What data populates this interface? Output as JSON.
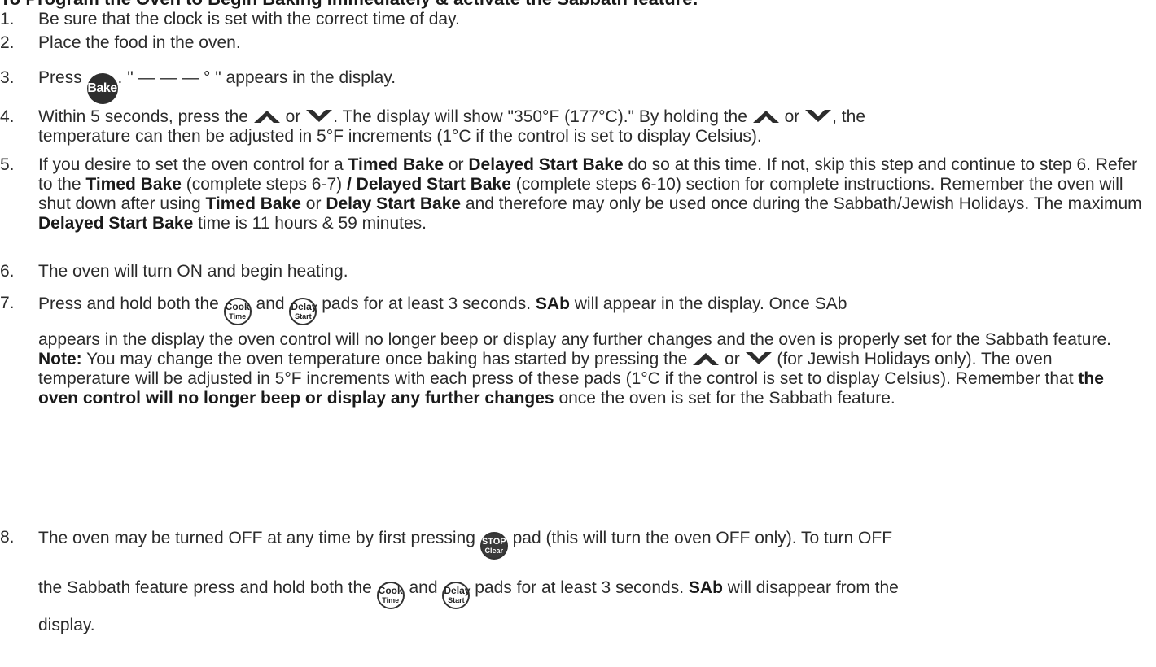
{
  "heading": "To Program the Oven to Begin Baking Immediately & activate the Sabbath feature:",
  "icons": {
    "bake": "Bake",
    "cook_time": [
      "Cook",
      "Time"
    ],
    "delay_start": [
      "Delay",
      "Start"
    ],
    "stop_clear": [
      "STOP",
      "Clear"
    ],
    "up": "up-arrow-pad",
    "down": "down-arrow-pad"
  },
  "steps": [
    {
      "num": "1.",
      "text": "Be sure that the clock is set with the correct time of day."
    },
    {
      "num": "2.",
      "text": "Place the food in the oven."
    },
    {
      "num": "3.",
      "a": "Press",
      "b": ". \" — — — ° \" appears in the display."
    },
    {
      "num": "4.",
      "a": "Within 5 seconds, press the",
      "or1": "or",
      "b": ". The display will show \"350°F (177°C).\" By holding the",
      "or2": "or",
      "c": ", the",
      "d": "temperature can then be adjusted in 5°F increments (1°C if the control is set to display Celsius)."
    },
    {
      "num": "5.",
      "t1": "If you desire to set the oven control for a ",
      "b1": "Timed Bake",
      "t2": " or ",
      "b2": "Delayed Start Bake",
      "t3": " do so at this time. If not, skip this step and continue to step 6. Refer to the ",
      "b3": "Timed Bake",
      "t4": " (complete steps 6-7) ",
      "b4": "/ Delayed Start Bake",
      "t5": " (complete steps 6-10) section for complete instructions. Remember the oven will shut down after using ",
      "b5": "Timed Bake",
      "t6": " or ",
      "b6": "Delay Start Bake",
      "t7": " and therefore may only be used once during the Sabbath/Jewish Holidays. The maximum ",
      "b7": "Delayed Start Bake",
      "t8": " time is 11 hours & 59 minutes."
    },
    {
      "num": "6.",
      "text": "The oven will turn ON and begin heating."
    },
    {
      "num": "7.",
      "a": "Press and hold both the",
      "and": "and",
      "b": "pads for at least 3 seconds.",
      "sab": "SAb",
      "c": "will appear in the display. Once SAb",
      "d": "appears in the display the oven control will no longer beep or display any further changes and the oven is properly set for the Sabbath feature.",
      "note_label": "Note:",
      "note_a": "You may change the oven temperature once baking has started by pressing the",
      "note_or": "or",
      "note_b": "(for Jewish Holidays only). The oven temperature will be adjusted in 5°F increments with each press of these pads (1°C if the control is set to display Celsius). Remember that",
      "note_bold": "the oven control will no longer beep or display any further changes",
      "note_c": "once the oven is set for the Sabbath feature."
    },
    {
      "num": "8.",
      "a": "The oven may be turned OFF at any time by first pressing",
      "b": "pad (this will turn the oven OFF only). To turn OFF",
      "c": "the Sabbath feature press and hold both the",
      "and": "and",
      "d": "pads for at least 3 seconds.",
      "sab": "SAb",
      "e": "will disappear from the",
      "f": "display."
    }
  ]
}
